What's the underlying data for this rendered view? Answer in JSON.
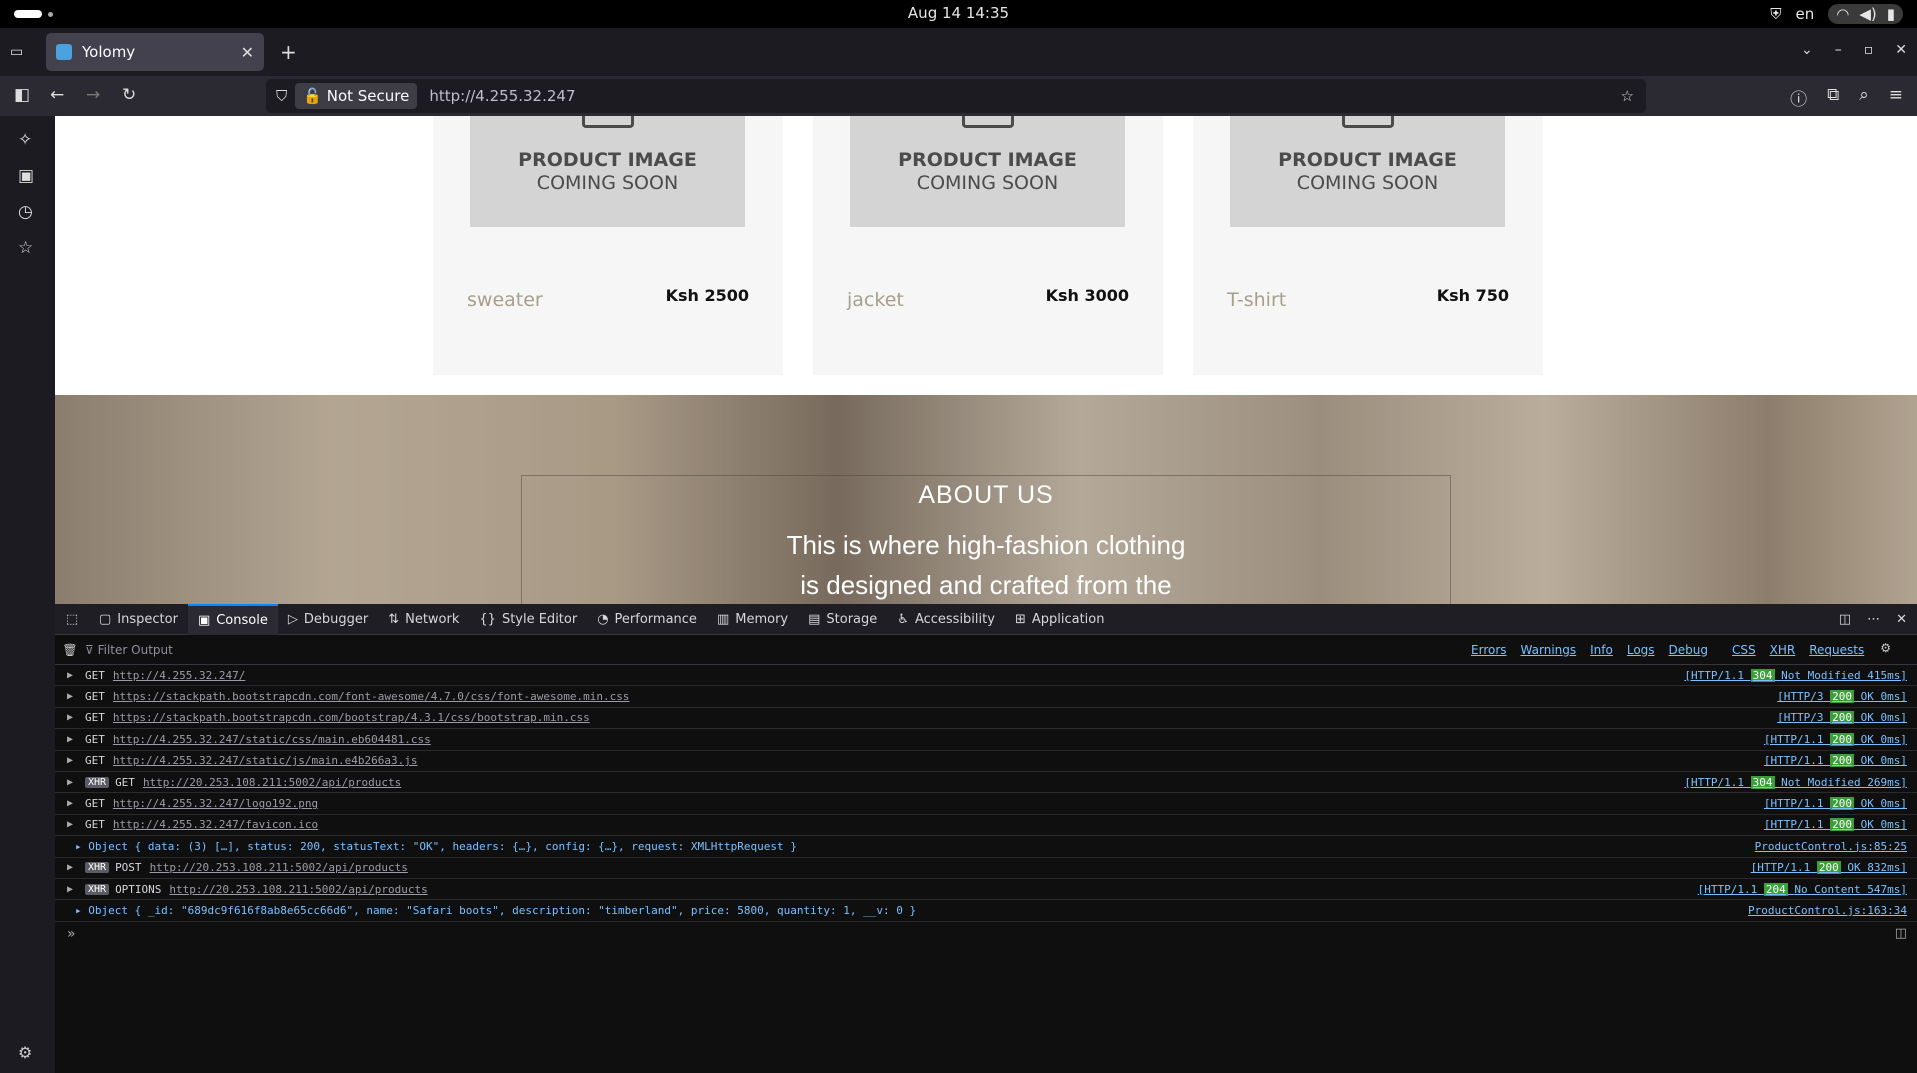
{
  "topbar": {
    "datetime": "Aug 14  14:35",
    "lang": "en"
  },
  "browser": {
    "tab_title": "Yolomy",
    "security_label": "Not Secure",
    "url": "http://4.255.32.247"
  },
  "products": [
    {
      "line1": "PRODUCT IMAGE",
      "line2": "COMING SOON",
      "name": "sweater",
      "price": "Ksh 2500"
    },
    {
      "line1": "PRODUCT IMAGE",
      "line2": "COMING SOON",
      "name": "jacket",
      "price": "Ksh 3000"
    },
    {
      "line1": "PRODUCT IMAGE",
      "line2": "COMING SOON",
      "name": "T-shirt",
      "price": "Ksh 750"
    }
  ],
  "about": {
    "heading": "ABOUT US",
    "text": "This is where high-fashion clothing is designed and crafted from the heart by"
  },
  "devtools": {
    "tabs": [
      "Inspector",
      "Console",
      "Debugger",
      "Network",
      "Style Editor",
      "Performance",
      "Memory",
      "Storage",
      "Accessibility",
      "Application"
    ],
    "active_tab": "Console",
    "filter_placeholder": "Filter Output",
    "filters": [
      "Errors",
      "Warnings",
      "Info",
      "Logs",
      "Debug",
      "CSS",
      "XHR",
      "Requests"
    ],
    "log": [
      {
        "xhr": false,
        "method": "GET",
        "url": "http://4.255.32.247/",
        "proto": "[HTTP/1.1",
        "code": "304",
        "status": "Not Modified 415ms]"
      },
      {
        "xhr": false,
        "method": "GET",
        "url": "https://stackpath.bootstrapcdn.com/font-awesome/4.7.0/css/font-awesome.min.css",
        "proto": "[HTTP/3",
        "code": "200",
        "status": "OK 0ms]"
      },
      {
        "xhr": false,
        "method": "GET",
        "url": "https://stackpath.bootstrapcdn.com/bootstrap/4.3.1/css/bootstrap.min.css",
        "proto": "[HTTP/3",
        "code": "200",
        "status": "OK 0ms]"
      },
      {
        "xhr": false,
        "method": "GET",
        "url": "http://4.255.32.247/static/css/main.eb604481.css",
        "proto": "[HTTP/1.1",
        "code": "200",
        "status": "OK 0ms]"
      },
      {
        "xhr": false,
        "method": "GET",
        "url": "http://4.255.32.247/static/js/main.e4b266a3.js",
        "proto": "[HTTP/1.1",
        "code": "200",
        "status": "OK 0ms]"
      },
      {
        "xhr": true,
        "method": "GET",
        "url": "http://20.253.108.211:5002/api/products",
        "proto": "[HTTP/1.1",
        "code": "304",
        "status": "Not Modified 269ms]"
      },
      {
        "xhr": false,
        "method": "GET",
        "url": "http://4.255.32.247/logo192.png",
        "proto": "[HTTP/1.1",
        "code": "200",
        "status": "OK 0ms]"
      },
      {
        "xhr": false,
        "method": "GET",
        "url": "http://4.255.32.247/favicon.ico",
        "proto": "[HTTP/1.1",
        "code": "200",
        "status": "OK 0ms]"
      }
    ],
    "object1": {
      "text": "Object { data: (3) […], status: 200, statusText: \"OK\", headers: {…}, config: {…}, request: XMLHttpRequest }",
      "source": "ProductControl.js:85:25"
    },
    "log2": [
      {
        "xhr": true,
        "method": "POST",
        "url": "http://20.253.108.211:5002/api/products",
        "proto": "[HTTP/1.1",
        "code": "200",
        "status": "OK 832ms]"
      },
      {
        "xhr": true,
        "method": "OPTIONS",
        "url": "http://20.253.108.211:5002/api/products",
        "proto": "[HTTP/1.1",
        "code": "204",
        "status": "No Content 547ms]"
      }
    ],
    "object2": {
      "text": "Object { _id: \"689dc9f616f8ab8e65cc66d6\", name: \"Safari boots\", description: \"timberland\", price: 5800, quantity: 1, __v: 0 }",
      "source": "ProductControl.js:163:34"
    },
    "prompt": "»"
  }
}
